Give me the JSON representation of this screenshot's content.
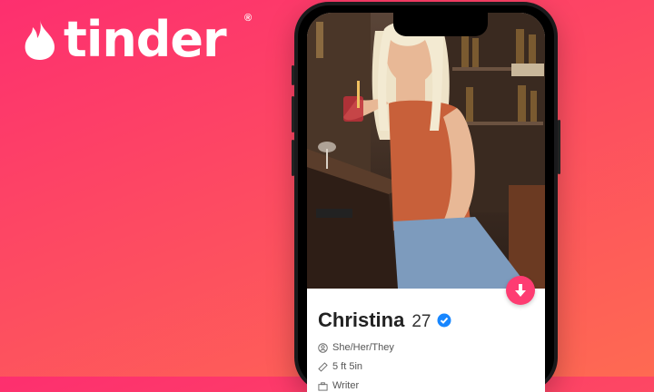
{
  "brand": {
    "name": "tinder",
    "registered": "®"
  },
  "profile": {
    "name": "Christina",
    "age": "27",
    "pronouns": "She/Her/They",
    "height": "5 ft 5in",
    "job": "Writer"
  },
  "icons": {
    "flame": "flame-icon",
    "verified": "verified-badge-icon",
    "download": "arrow-down-icon",
    "pronouns": "person-circle-icon",
    "height": "ruler-icon",
    "job": "briefcase-icon"
  },
  "colors": {
    "brand_pink": "#fe3c72",
    "verified_blue": "#1786ff"
  }
}
